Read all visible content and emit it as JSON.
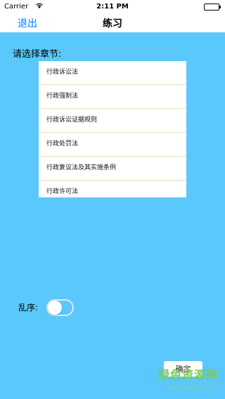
{
  "status_bar": {
    "carrier": "Carrier",
    "time": "2:11 PM"
  },
  "nav": {
    "back_label": "退出",
    "title": "练习"
  },
  "chapter_select": {
    "label": "请选择章节:",
    "items": [
      "行政诉讼法",
      "行政强制法",
      "行政诉讼证据规则",
      "行政处罚法",
      "行政复议法及其实施条例",
      "行政许可法"
    ]
  },
  "shuffle": {
    "label": "乱序:",
    "enabled": false
  },
  "confirm_label": "确定",
  "watermark": {
    "text": "绿色资源网",
    "url": "www.downcc.com"
  },
  "colors": {
    "background": "#5AC8FA",
    "accent": "#007AFF"
  }
}
